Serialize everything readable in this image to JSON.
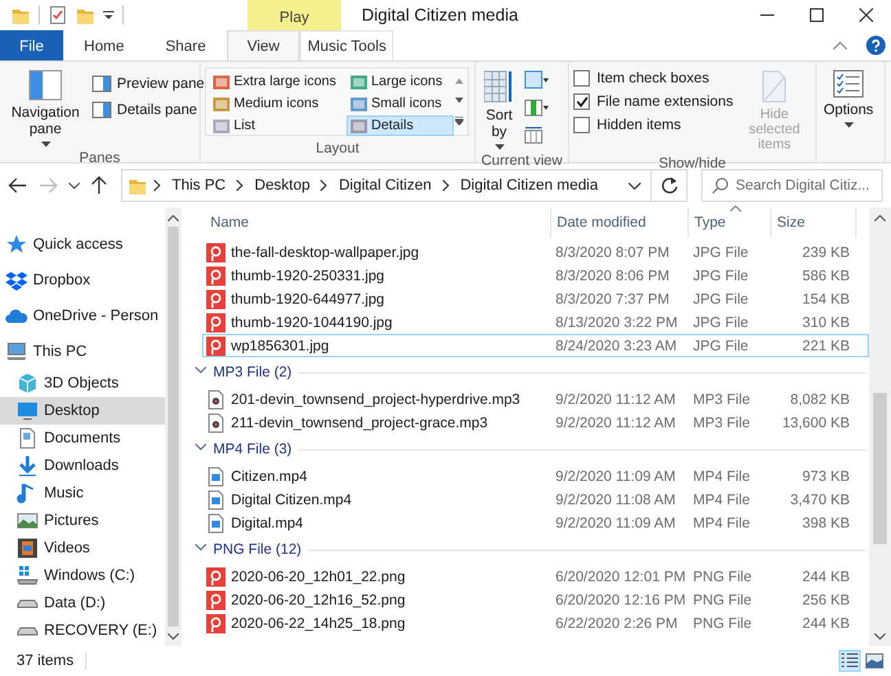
{
  "title_bar": {
    "title": "Digital Citizen media",
    "context_tab": "Play"
  },
  "ribbon_tabs": [
    {
      "label": "File",
      "kind": "file",
      "selected": false
    },
    {
      "label": "Home",
      "kind": "tab",
      "selected": false
    },
    {
      "label": "Share",
      "kind": "tab",
      "selected": false
    },
    {
      "label": "View",
      "kind": "tab",
      "selected": true
    },
    {
      "label": "Music Tools",
      "kind": "context",
      "selected": false
    }
  ],
  "ribbon": {
    "panes": {
      "label": "Panes",
      "navigation_pane": "Navigation pane",
      "buttons": [
        "Preview pane",
        "Details pane"
      ]
    },
    "layout": {
      "label": "Layout",
      "options": [
        {
          "label": "Extra large icons",
          "selected": false
        },
        {
          "label": "Large icons",
          "selected": false
        },
        {
          "label": "Medium icons",
          "selected": false
        },
        {
          "label": "Small icons",
          "selected": false
        },
        {
          "label": "List",
          "selected": false
        },
        {
          "label": "Details",
          "selected": true
        }
      ]
    },
    "current_view": {
      "label": "Current view",
      "sort": "Sort by"
    },
    "show_hide": {
      "label": "Show/hide",
      "checkboxes": [
        {
          "label": "Item check boxes",
          "checked": false
        },
        {
          "label": "File name extensions",
          "checked": true
        },
        {
          "label": "Hidden items",
          "checked": false
        }
      ],
      "hide_selected": {
        "label": "Hide selected items",
        "disabled": true
      }
    },
    "options": {
      "label": "Options"
    }
  },
  "address_bar": {
    "crumbs": [
      "This PC",
      "Desktop",
      "Digital Citizen",
      "Digital Citizen media"
    ]
  },
  "search": {
    "placeholder": "Search Digital Citiz..."
  },
  "navigation": [
    {
      "label": "Quick access",
      "kind": "star",
      "selected": false
    },
    {
      "label": "Dropbox",
      "kind": "dropbox",
      "selected": false
    },
    {
      "label": "OneDrive - Person",
      "kind": "cloud",
      "selected": false
    },
    {
      "label": "This PC",
      "kind": "pc",
      "selected": false,
      "children": [
        {
          "label": "3D Objects",
          "kind": "cube",
          "selected": false
        },
        {
          "label": "Desktop",
          "kind": "desktop",
          "selected": true
        },
        {
          "label": "Documents",
          "kind": "document",
          "selected": false
        },
        {
          "label": "Downloads",
          "kind": "download",
          "selected": false
        },
        {
          "label": "Music",
          "kind": "music",
          "selected": false
        },
        {
          "label": "Pictures",
          "kind": "pictures",
          "selected": false
        },
        {
          "label": "Videos",
          "kind": "videos",
          "selected": false
        },
        {
          "label": "Windows (C:)",
          "kind": "windows-drive",
          "selected": false
        },
        {
          "label": "Data (D:)",
          "kind": "drive",
          "selected": false
        },
        {
          "label": "RECOVERY (E:)",
          "kind": "drive",
          "selected": false
        }
      ]
    }
  ],
  "file_list": {
    "columns": [
      {
        "label": "Name",
        "sorted": false
      },
      {
        "label": "Date modified",
        "sorted": false
      },
      {
        "label": "Type",
        "sorted": true
      },
      {
        "label": "Size",
        "sorted": false
      }
    ],
    "groups": [
      {
        "rows": [
          {
            "name": "the-fall-desktop-wallpaper.jpg",
            "date": "8/3/2020 8:07 PM",
            "type": "JPG File",
            "size": "239 KB",
            "kind": "image",
            "focused": false
          },
          {
            "name": "thumb-1920-250331.jpg",
            "date": "8/3/2020 8:06 PM",
            "type": "JPG File",
            "size": "586 KB",
            "kind": "image",
            "focused": false
          },
          {
            "name": "thumb-1920-644977.jpg",
            "date": "8/3/2020 7:37 PM",
            "type": "JPG File",
            "size": "154 KB",
            "kind": "image",
            "focused": false
          },
          {
            "name": "thumb-1920-1044190.jpg",
            "date": "8/13/2020 3:22 PM",
            "type": "JPG File",
            "size": "310 KB",
            "kind": "image",
            "focused": false
          },
          {
            "name": "wp1856301.jpg",
            "date": "8/24/2020 3:23 AM",
            "type": "JPG File",
            "size": "221 KB",
            "kind": "image",
            "focused": true
          }
        ]
      },
      {
        "label": "MP3 File (2)",
        "expanded": true,
        "rows": [
          {
            "name": "201-devin_townsend_project-hyperdrive.mp3",
            "date": "9/2/2020 11:12 AM",
            "type": "MP3 File",
            "size": "8,082 KB",
            "kind": "audio",
            "focused": false
          },
          {
            "name": "211-devin_townsend_project-grace.mp3",
            "date": "9/2/2020 11:12 AM",
            "type": "MP3 File",
            "size": "13,600 KB",
            "kind": "audio",
            "focused": false
          }
        ]
      },
      {
        "label": "MP4 File (3)",
        "expanded": true,
        "rows": [
          {
            "name": "Citizen.mp4",
            "date": "9/2/2020 11:09 AM",
            "type": "MP4 File",
            "size": "973 KB",
            "kind": "video",
            "focused": false
          },
          {
            "name": "Digital Citizen.mp4",
            "date": "9/2/2020 11:08 AM",
            "type": "MP4 File",
            "size": "3,470 KB",
            "kind": "video",
            "focused": false
          },
          {
            "name": "Digital.mp4",
            "date": "9/2/2020 11:09 AM",
            "type": "MP4 File",
            "size": "398 KB",
            "kind": "video",
            "focused": false
          }
        ]
      },
      {
        "label": "PNG File (12)",
        "expanded": true,
        "rows": [
          {
            "name": "2020-06-20_12h01_22.png",
            "date": "6/20/2020 12:01 PM",
            "type": "PNG File",
            "size": "244 KB",
            "kind": "image",
            "focused": false
          },
          {
            "name": "2020-06-20_12h16_52.png",
            "date": "6/20/2020 12:16 PM",
            "type": "PNG File",
            "size": "256 KB",
            "kind": "image",
            "focused": false
          },
          {
            "name": "2020-06-22_14h25_18.png",
            "date": "6/22/2020 2:26 PM",
            "type": "PNG File",
            "size": "244 KB",
            "kind": "image",
            "focused": false
          }
        ]
      }
    ]
  },
  "status_bar": {
    "count": "37 items",
    "views": [
      {
        "kind": "details",
        "selected": true
      },
      {
        "kind": "large-icons",
        "selected": false
      }
    ]
  }
}
